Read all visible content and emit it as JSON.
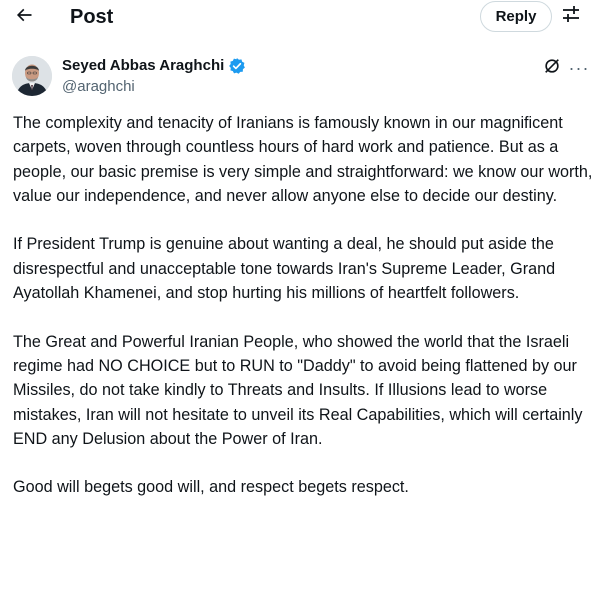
{
  "header": {
    "back_icon": "arrow-left-icon",
    "title": "Post",
    "reply_label": "Reply",
    "filter_icon": "sliders-icon"
  },
  "author": {
    "name": "Seyed Abbas Araghchi",
    "handle": "@araghchi",
    "verified_color": "#1d9bf0",
    "grok_icon": "grok-icon",
    "more_icon": "more-horizontal-icon",
    "more_label": "···"
  },
  "post": {
    "paragraphs": [
      "The complexity and tenacity of Iranians is famously known in our magnificent carpets, woven through countless hours of hard work and patience. But as a people, our basic premise is very simple and straightforward: we know our worth, value our independence, and never allow anyone else to decide our destiny.",
      "If President Trump is genuine about wanting a deal, he should put aside the disrespectful and unacceptable tone towards Iran's Supreme Leader, Grand Ayatollah Khamenei, and stop hurting his millions of heartfelt followers.",
      "The Great and Powerful Iranian People, who showed the world that the Israeli regime had NO CHOICE but to RUN to \"Daddy\" to avoid being flattened by our Missiles, do not take kindly to Threats and Insults. If Illusions lead to worse mistakes, Iran will not hesitate to unveil its Real Capabilities, which will certainly END any Delusion about the Power of Iran.",
      "Good will begets good will, and respect begets respect."
    ]
  },
  "colors": {
    "text": "#0f1419",
    "secondary": "#536471",
    "border": "#cfd9de"
  }
}
